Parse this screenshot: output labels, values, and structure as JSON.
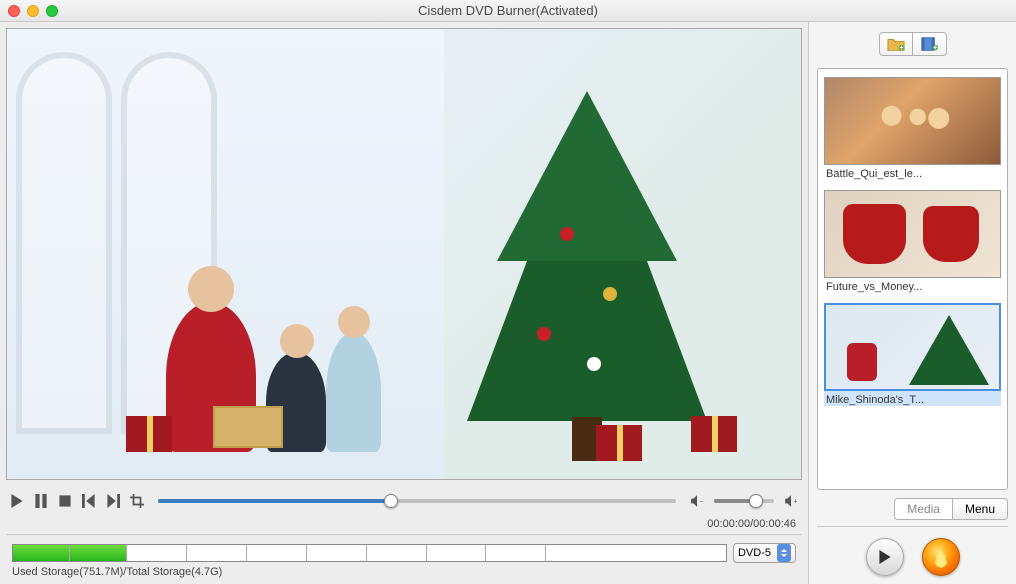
{
  "window": {
    "title": "Cisdem DVD Burner(Activated)"
  },
  "playback": {
    "current": "00:00:00",
    "duration": "00:00:46",
    "timecode": "00:00:00/00:00:46"
  },
  "storage": {
    "disc_type": "DVD-5",
    "label": "Used Storage(751.7M)/Total Storage(4.7G)"
  },
  "tabs": {
    "media": "Media",
    "menu": "Menu"
  },
  "media_items": [
    {
      "label": "Battle_Qui_est_le..."
    },
    {
      "label": "Future_vs_Money..."
    },
    {
      "label": "Mike_Shinoda's_T..."
    }
  ],
  "icons": {
    "add_folder": "folder-plus",
    "add_video": "film-plus"
  }
}
